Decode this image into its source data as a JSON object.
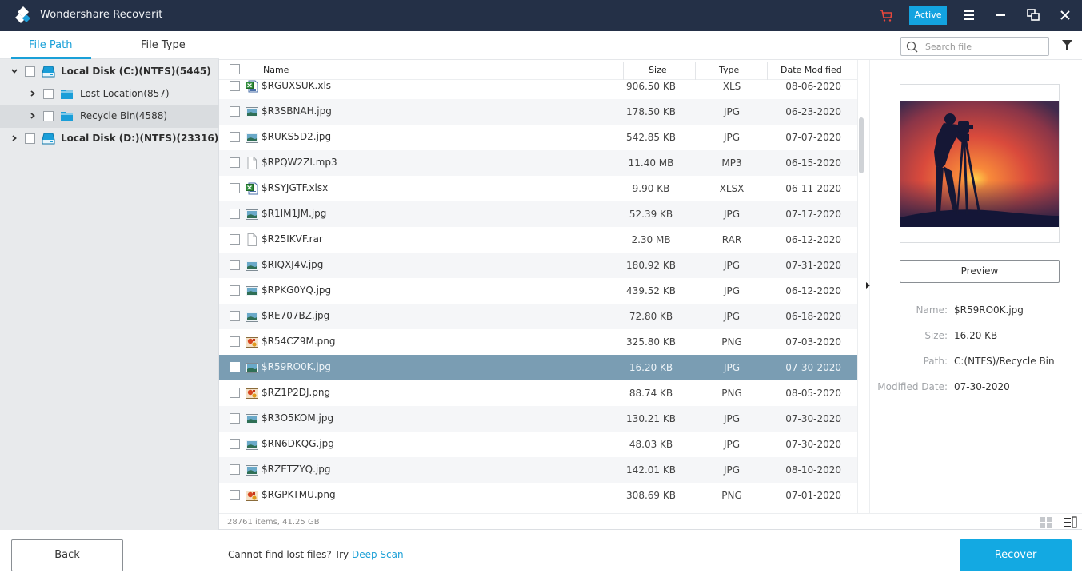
{
  "titlebar": {
    "app_title": "Wondershare Recoverit",
    "active_label": "Active",
    "icons": [
      "logo-icon",
      "cart-icon",
      "menu-icon",
      "minimize-icon",
      "restore-icon",
      "close-icon"
    ]
  },
  "left_panel": {
    "tabs": [
      {
        "label": "File Path",
        "active": true
      },
      {
        "label": "File Type",
        "active": false
      }
    ],
    "tree": [
      {
        "label": "Local Disk (C:)(NTFS)(5445)",
        "expanded": true,
        "level": 0,
        "icon": "disk-icon"
      },
      {
        "label": "Lost Location(857)",
        "expanded": false,
        "level": 1,
        "icon": "folder-icon"
      },
      {
        "label": "Recycle Bin(4588)",
        "expanded": false,
        "level": 1,
        "icon": "folder-icon",
        "selected": true
      },
      {
        "label": "Local Disk (D:)(NTFS)(23316)",
        "expanded": false,
        "level": 0,
        "icon": "disk-icon"
      }
    ]
  },
  "toolbar": {
    "search_placeholder": "Search file",
    "filter_icon": "filter-icon"
  },
  "file_list": {
    "columns": {
      "name": "Name",
      "size": "Size",
      "type": "Type",
      "date": "Date Modified"
    },
    "rows": [
      {
        "name": "$RGUXSUK.xls",
        "size": "906.50 KB",
        "type": "XLS",
        "date": "08-06-2020",
        "icon": "excel-file-icon"
      },
      {
        "name": "$R3SBNAH.jpg",
        "size": "178.50 KB",
        "type": "JPG",
        "date": "06-23-2020",
        "icon": "image-file-icon"
      },
      {
        "name": "$RUKS5D2.jpg",
        "size": "542.85 KB",
        "type": "JPG",
        "date": "07-07-2020",
        "icon": "image-file-icon"
      },
      {
        "name": "$RPQW2ZI.mp3",
        "size": "11.40 MB",
        "type": "MP3",
        "date": "06-15-2020",
        "icon": "generic-file-icon"
      },
      {
        "name": "$RSYJGTF.xlsx",
        "size": "9.90 KB",
        "type": "XLSX",
        "date": "06-11-2020",
        "icon": "excel-file-icon"
      },
      {
        "name": "$R1IM1JM.jpg",
        "size": "52.39 KB",
        "type": "JPG",
        "date": "07-17-2020",
        "icon": "image-file-icon"
      },
      {
        "name": "$R25IKVF.rar",
        "size": "2.30 MB",
        "type": "RAR",
        "date": "06-12-2020",
        "icon": "generic-file-icon"
      },
      {
        "name": "$RIQXJ4V.jpg",
        "size": "180.92 KB",
        "type": "JPG",
        "date": "07-31-2020",
        "icon": "image-file-icon"
      },
      {
        "name": "$RPKG0YQ.jpg",
        "size": "439.52 KB",
        "type": "JPG",
        "date": "06-12-2020",
        "icon": "image-file-icon"
      },
      {
        "name": "$RE707BZ.jpg",
        "size": "72.80 KB",
        "type": "JPG",
        "date": "06-18-2020",
        "icon": "image-file-icon"
      },
      {
        "name": "$R54CZ9M.png",
        "size": "325.80 KB",
        "type": "PNG",
        "date": "07-03-2020",
        "icon": "png-file-icon"
      },
      {
        "name": "$R59RO0K.jpg",
        "size": "16.20 KB",
        "type": "JPG",
        "date": "07-30-2020",
        "icon": "image-file-icon",
        "selected": true
      },
      {
        "name": "$RZ1P2DJ.png",
        "size": "88.74 KB",
        "type": "PNG",
        "date": "08-05-2020",
        "icon": "png-file-icon"
      },
      {
        "name": "$R3O5KOM.jpg",
        "size": "130.21 KB",
        "type": "JPG",
        "date": "07-30-2020",
        "icon": "image-file-icon"
      },
      {
        "name": "$RN6DKQG.jpg",
        "size": "48.03 KB",
        "type": "JPG",
        "date": "07-30-2020",
        "icon": "image-file-icon"
      },
      {
        "name": "$RZETZYQ.jpg",
        "size": "142.01 KB",
        "type": "JPG",
        "date": "08-10-2020",
        "icon": "image-file-icon"
      },
      {
        "name": "$RGPKTMU.png",
        "size": "308.69 KB",
        "type": "PNG",
        "date": "07-01-2020",
        "icon": "png-file-icon"
      }
    ]
  },
  "status": {
    "summary": "28761 items, 41.25 GB"
  },
  "details": {
    "preview_label": "Preview",
    "fields": [
      {
        "label": "Name:",
        "value": "$R59RO0K.jpg"
      },
      {
        "label": "Size:",
        "value": "16.20 KB"
      },
      {
        "label": "Path:",
        "value": "C:(NTFS)/Recycle Bin"
      },
      {
        "label": "Modified Date:",
        "value": "07-30-2020"
      }
    ]
  },
  "bottom": {
    "back_label": "Back",
    "hint_text": "Cannot find lost files? Try ",
    "deep_scan_label": "Deep Scan",
    "recover_label": "Recover"
  },
  "colors": {
    "titlebar": "#243047",
    "accent": "#13a9e2",
    "selected_row": "#7a9db3",
    "cart": "#e8473c"
  }
}
